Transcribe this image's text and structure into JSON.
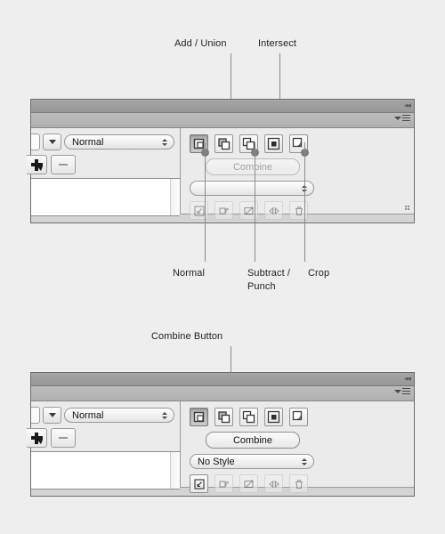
{
  "annotations": {
    "add_union": "Add / Union",
    "intersect": "Intersect",
    "normal": "Normal",
    "subtract_punch": "Subtract /\nPunch",
    "crop": "Crop",
    "combine_button": "Combine Button"
  },
  "colors": {
    "page_background": "#eeeeee",
    "panel_background": "#ebebeb",
    "panel_border": "#6d6d6d",
    "tabstrip": "#9d9d9d",
    "titlebar": "#b6b6b6",
    "leader_line": "#8b8b8b",
    "dot": "#7d7d7d",
    "text": "#222222",
    "disabled_text": "#a2a2a2"
  },
  "panel_top": {
    "collapse_icon": "collapse-double-arrow-icon",
    "menu_icon": "panel-menu-icon",
    "blend_mode": {
      "value": "Normal",
      "placeholder": "Normal"
    },
    "add_button_label": "add-appearance",
    "remove_button_label": "remove-appearance",
    "shape_modes": [
      {
        "name": "normal-mode",
        "label": "Normal",
        "selected": true
      },
      {
        "name": "add-union",
        "label": "Add / Union",
        "selected": false
      },
      {
        "name": "subtract-punch",
        "label": "Subtract / Punch",
        "selected": false
      },
      {
        "name": "intersect",
        "label": "Intersect",
        "selected": false
      },
      {
        "name": "crop",
        "label": "Crop",
        "selected": false
      }
    ],
    "combine": {
      "label": "Combine",
      "enabled": false
    },
    "style": {
      "value": "",
      "placeholder": ""
    },
    "pathfinders": [
      {
        "name": "expand",
        "enabled": false
      },
      {
        "name": "revert",
        "enabled": false
      },
      {
        "name": "trim",
        "enabled": false
      },
      {
        "name": "scatter",
        "enabled": false
      },
      {
        "name": "delete",
        "enabled": false
      }
    ]
  },
  "panel_bottom": {
    "collapse_icon": "collapse-double-arrow-icon",
    "menu_icon": "panel-menu-icon",
    "blend_mode": {
      "value": "Normal",
      "placeholder": "Normal"
    },
    "shape_modes": [
      {
        "name": "normal-mode",
        "label": "Normal",
        "selected": true
      },
      {
        "name": "add-union",
        "label": "Add / Union",
        "selected": false
      },
      {
        "name": "subtract-punch",
        "label": "Subtract / Punch",
        "selected": false
      },
      {
        "name": "intersect",
        "label": "Intersect",
        "selected": false
      },
      {
        "name": "crop",
        "label": "Crop",
        "selected": false
      }
    ],
    "combine": {
      "label": "Combine",
      "enabled": true
    },
    "style": {
      "value": "No Style",
      "placeholder": "No Style"
    },
    "pathfinders": [
      {
        "name": "expand",
        "enabled": true
      },
      {
        "name": "revert",
        "enabled": false
      },
      {
        "name": "trim",
        "enabled": false
      },
      {
        "name": "scatter",
        "enabled": false
      },
      {
        "name": "delete",
        "enabled": false
      }
    ]
  }
}
